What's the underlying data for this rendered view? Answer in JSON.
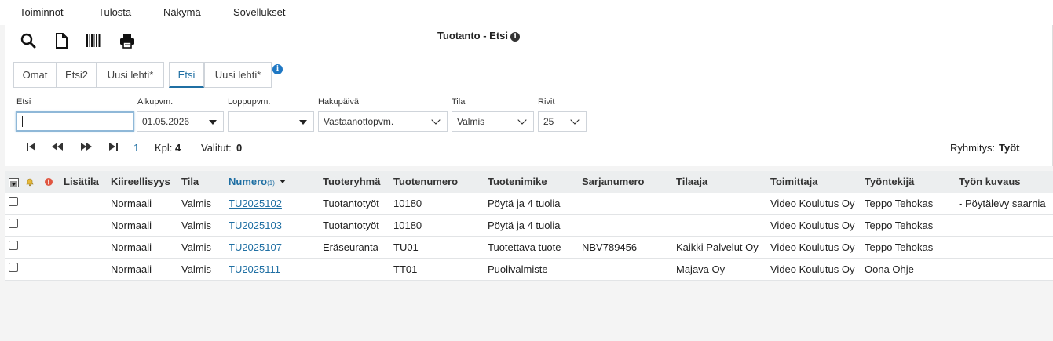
{
  "menu": [
    "Toiminnot",
    "Tulosta",
    "Näkymä",
    "Sovellukset"
  ],
  "toolbar": {
    "icons": [
      "search-icon",
      "new-document-icon",
      "barcode-icon",
      "print-icon"
    ]
  },
  "title": "Tuotanto - Etsi",
  "tabs": [
    {
      "label": "Omat",
      "active": false
    },
    {
      "label": "Etsi2",
      "active": false
    },
    {
      "label": "Uusi lehti*",
      "active": false
    },
    {
      "label": "Etsi",
      "active": true
    },
    {
      "label": "Uusi lehti*",
      "active": false
    }
  ],
  "filters": {
    "search": {
      "label": "Etsi",
      "value": ""
    },
    "start_date": {
      "label": "Alkupvm.",
      "value": "01.05.2026"
    },
    "end_date": {
      "label": "Loppupvm.",
      "value": ""
    },
    "date_type": {
      "label": "Hakupäivä",
      "value": "Vastaanottopvm."
    },
    "status": {
      "label": "Tila",
      "value": "Valmis"
    },
    "rows": {
      "label": "Rivit",
      "value": "25"
    }
  },
  "pager": {
    "page": "1",
    "count_label": "Kpl:",
    "count": "4",
    "selected_label": "Valitut:",
    "selected": "0",
    "grouping_label": "Ryhmitys:",
    "grouping": "Työt"
  },
  "table": {
    "columns": [
      "Lisätila",
      "Kiireellisyys",
      "Tila",
      "Numero",
      "Tuoteryhmä",
      "Tuotenumero",
      "Tuotenimike",
      "Sarjanumero",
      "Tilaaja",
      "Toimittaja",
      "Työntekijä",
      "Työn kuvaus"
    ],
    "sort_indicator": "(1)",
    "rows": [
      [
        "",
        "Normaali",
        "Valmis",
        "TU2025102",
        "Tuotantotyöt",
        "10180",
        "Pöytä ja 4 tuolia",
        "",
        "",
        "Video Koulutus Oy",
        "Teppo Tehokas",
        "- Pöytälevy saarnia"
      ],
      [
        "",
        "Normaali",
        "Valmis",
        "TU2025103",
        "Tuotantotyöt",
        "10180",
        "Pöytä ja 4 tuolia",
        "",
        "",
        "Video Koulutus Oy",
        "Teppo Tehokas",
        ""
      ],
      [
        "",
        "Normaali",
        "Valmis",
        "TU2025107",
        "Eräseuranta",
        "TU01",
        "Tuotettava tuote",
        "NBV789456",
        "Kaikki Palvelut Oy",
        "Video Koulutus Oy",
        "Teppo Tehokas",
        ""
      ],
      [
        "",
        "Normaali",
        "Valmis",
        "TU2025111",
        "",
        "TT01",
        "Puolivalmiste",
        "",
        "Majava Oy",
        "Video Koulutus Oy",
        "Oona Ohje",
        ""
      ]
    ]
  }
}
